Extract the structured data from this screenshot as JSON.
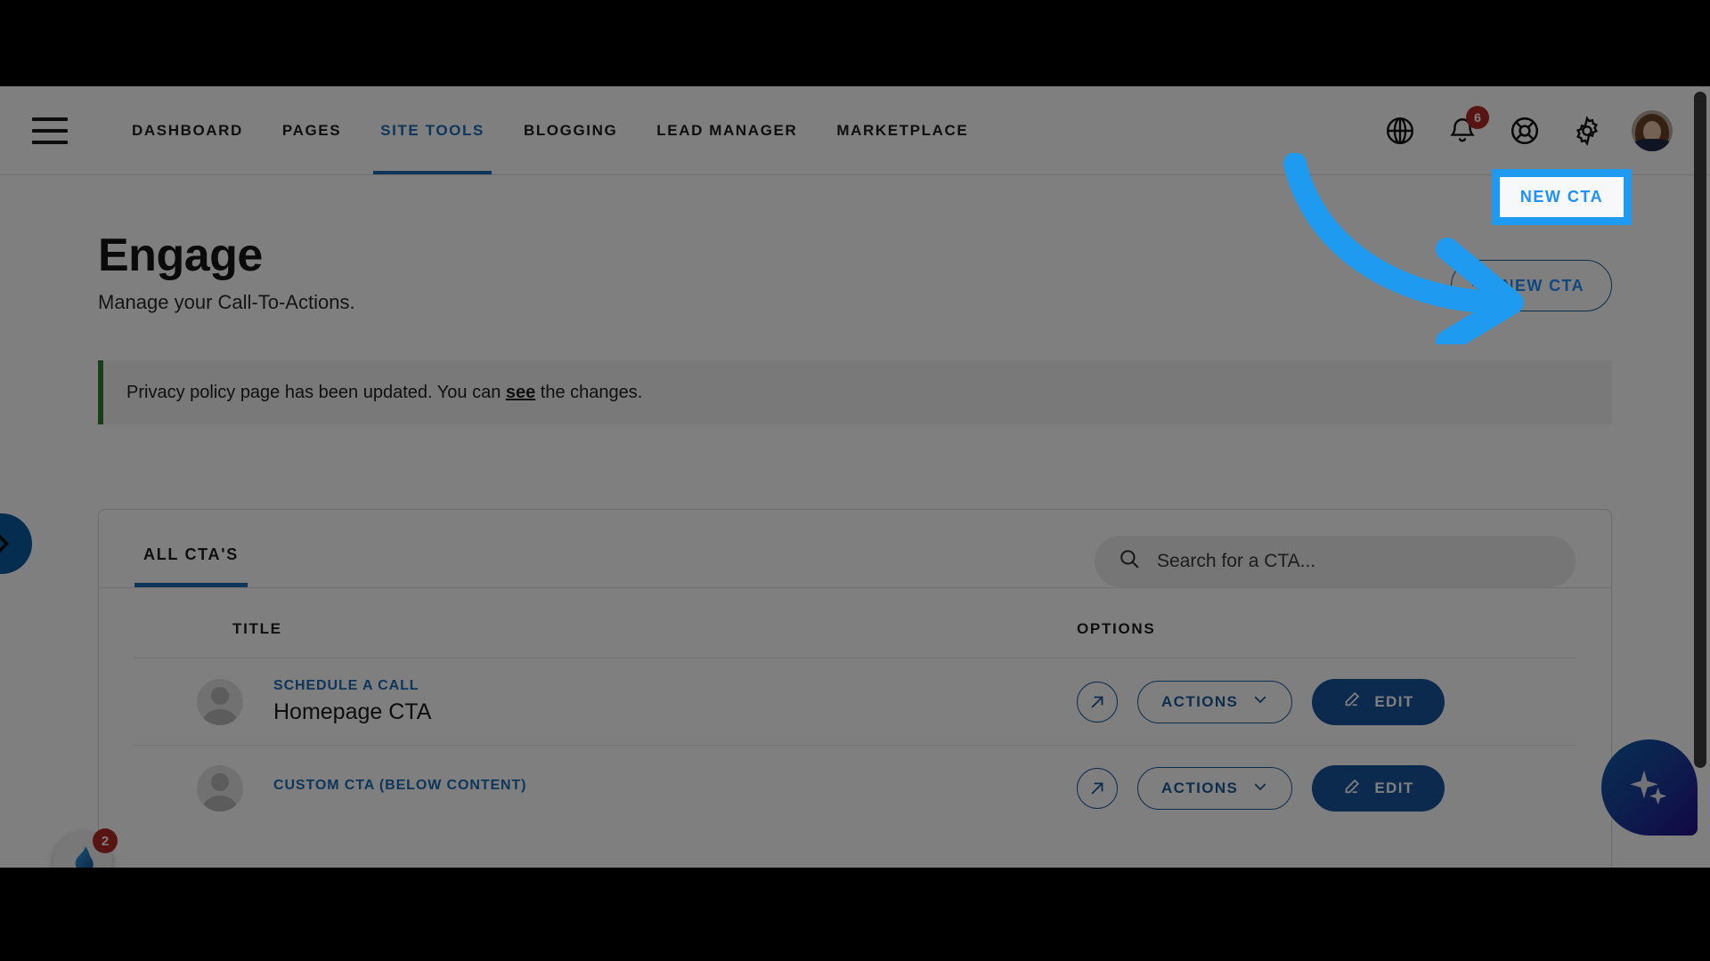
{
  "navbar": {
    "menu_icon": "hamburger-menu-icon",
    "links": [
      {
        "label": "DASHBOARD",
        "active": false
      },
      {
        "label": "PAGES",
        "active": false
      },
      {
        "label": "SITE TOOLS",
        "active": true
      },
      {
        "label": "BLOGGING",
        "active": false
      },
      {
        "label": "LEAD MANAGER",
        "active": false
      },
      {
        "label": "MARKETPLACE",
        "active": false
      }
    ],
    "icons": [
      {
        "name": "globe-icon",
        "badge": null
      },
      {
        "name": "bell-notifications-icon",
        "badge": "6"
      },
      {
        "name": "lifebuoy-support-icon",
        "badge": null
      },
      {
        "name": "gear-settings-icon",
        "badge": null
      }
    ],
    "avatar_alt": "user-avatar"
  },
  "page": {
    "title": "Engage",
    "subtitle": "Manage your Call-To-Actions.",
    "new_cta_label": "NEW CTA",
    "new_cta_plus": "+"
  },
  "banner": {
    "text_before": "Privacy policy page has been updated. You can ",
    "link": "see",
    "text_after": " the changes.",
    "accent_color": "#2e7d32"
  },
  "card": {
    "tab_label": "ALL CTA'S",
    "search_placeholder": "Search for a CTA...",
    "search_value": "",
    "search_icon": "search-icon",
    "columns": {
      "title": "TITLE",
      "options": "OPTIONS"
    },
    "rows": [
      {
        "kicker": "SCHEDULE A CALL",
        "title": "Homepage CTA",
        "open_icon": "external-link-icon",
        "actions_label": "ACTIONS",
        "edit_label": "EDIT"
      },
      {
        "kicker": "CUSTOM CTA (BELOW CONTENT)",
        "title": "",
        "open_icon": "external-link-icon",
        "actions_label": "ACTIONS",
        "edit_label": "EDIT"
      }
    ]
  },
  "widgets": {
    "side_toggle_icon": "chevron-right-icon",
    "chat_icon": "flame-chat-icon",
    "chat_badge": "2",
    "ai_icon": "sparkle-ai-icon"
  },
  "annotation": {
    "arrow_color": "#1e9bf0",
    "highlight_color": "#1e9bf0",
    "target_label": "NEW CTA"
  },
  "colors": {
    "brand_blue": "#1b6cb5",
    "link_blue": "#1e90ff",
    "dark_blue": "#17559b",
    "badge_red": "#b02626",
    "green": "#2e7d32"
  }
}
